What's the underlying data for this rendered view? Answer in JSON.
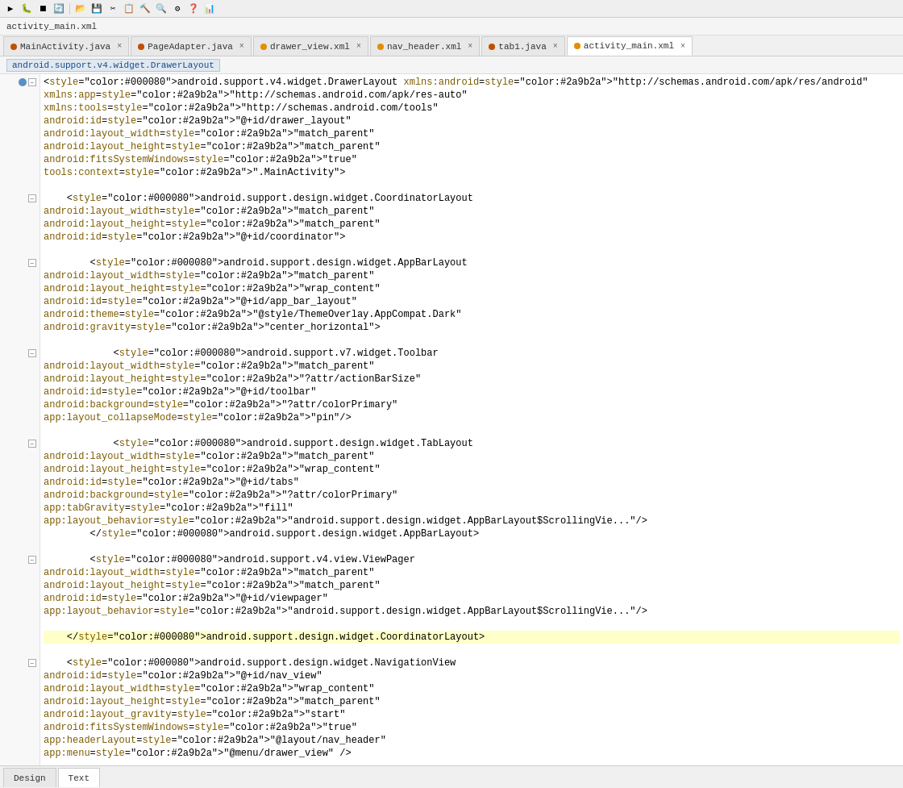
{
  "toolbar": {
    "icons": [
      "▶",
      "⏸",
      "⏹",
      "🔄",
      "📁",
      "💾",
      "✂",
      "📋",
      "📌",
      "🔍",
      "⚙",
      "❓",
      "📊"
    ]
  },
  "breadcrumb": {
    "text": "activity_main.xml"
  },
  "tabs": [
    {
      "id": "main-activity",
      "label": "MainActivity.java",
      "color": "#c05000",
      "active": false,
      "closeable": true
    },
    {
      "id": "page-adapter",
      "label": "PageAdapter.java",
      "color": "#c05000",
      "active": false,
      "closeable": true
    },
    {
      "id": "drawer-view",
      "label": "drawer_view.xml",
      "color": "#e09000",
      "active": false,
      "closeable": true
    },
    {
      "id": "nav-header",
      "label": "nav_header.xml",
      "color": "#e09000",
      "active": false,
      "closeable": true
    },
    {
      "id": "tab1",
      "label": "tab1.java",
      "color": "#c05000",
      "active": false,
      "closeable": true
    },
    {
      "id": "activity-main",
      "label": "activity_main.xml",
      "color": "#e09000",
      "active": true,
      "closeable": true
    }
  ],
  "file_path": "android.support.v4.widget.DrawerLayout",
  "code_lines": [
    {
      "indent": 0,
      "fold": true,
      "circle": true,
      "highlighted": false,
      "content": "<android.support.v4.widget.DrawerLayout xmlns:android=\"http://schemas.android.com/apk/res/android\""
    },
    {
      "indent": 1,
      "fold": false,
      "circle": false,
      "highlighted": false,
      "content": "    xmlns:app=\"http://schemas.android.com/apk/res-auto\""
    },
    {
      "indent": 1,
      "fold": false,
      "circle": false,
      "highlighted": false,
      "content": "    xmlns:tools=\"http://schemas.android.com/tools\""
    },
    {
      "indent": 1,
      "fold": false,
      "circle": false,
      "highlighted": false,
      "content": "    android:id=\"@+id/drawer_layout\""
    },
    {
      "indent": 1,
      "fold": false,
      "circle": false,
      "highlighted": false,
      "content": "    android:layout_width=\"match_parent\""
    },
    {
      "indent": 1,
      "fold": false,
      "circle": false,
      "highlighted": false,
      "content": "    android:layout_height=\"match_parent\""
    },
    {
      "indent": 1,
      "fold": false,
      "circle": false,
      "highlighted": false,
      "content": "    android:fitsSystemWindows=\"true\""
    },
    {
      "indent": 1,
      "fold": false,
      "circle": false,
      "highlighted": false,
      "content": "    tools:context=\".MainActivity\">"
    },
    {
      "indent": 0,
      "fold": false,
      "circle": false,
      "highlighted": false,
      "content": ""
    },
    {
      "indent": 1,
      "fold": true,
      "circle": false,
      "highlighted": false,
      "content": "    <android.support.design.widget.CoordinatorLayout"
    },
    {
      "indent": 2,
      "fold": false,
      "circle": false,
      "highlighted": false,
      "content": "        android:layout_width=\"match_parent\""
    },
    {
      "indent": 2,
      "fold": false,
      "circle": false,
      "highlighted": false,
      "content": "        android:layout_height=\"match_parent\""
    },
    {
      "indent": 2,
      "fold": false,
      "circle": false,
      "highlighted": false,
      "content": "        android:id=\"@+id/coordinator\">"
    },
    {
      "indent": 0,
      "fold": false,
      "circle": false,
      "highlighted": false,
      "content": ""
    },
    {
      "indent": 2,
      "fold": true,
      "circle": false,
      "highlighted": false,
      "content": "        <android.support.design.widget.AppBarLayout"
    },
    {
      "indent": 3,
      "fold": false,
      "circle": false,
      "highlighted": false,
      "content": "            android:layout_width=\"match_parent\""
    },
    {
      "indent": 3,
      "fold": false,
      "circle": false,
      "highlighted": false,
      "content": "            android:layout_height=\"wrap_content\""
    },
    {
      "indent": 3,
      "fold": false,
      "circle": false,
      "highlighted": false,
      "content": "            android:id=\"@+id/app_bar_layout\""
    },
    {
      "indent": 3,
      "fold": false,
      "circle": false,
      "highlighted": false,
      "content": "            android:theme=\"@style/ThemeOverlay.AppCompat.Dark\""
    },
    {
      "indent": 3,
      "fold": false,
      "circle": false,
      "highlighted": false,
      "content": "            android:gravity=\"center_horizontal\">"
    },
    {
      "indent": 0,
      "fold": false,
      "circle": false,
      "highlighted": false,
      "content": ""
    },
    {
      "indent": 3,
      "fold": true,
      "circle": false,
      "highlighted": false,
      "content": "            <android.support.v7.widget.Toolbar"
    },
    {
      "indent": 4,
      "fold": false,
      "circle": false,
      "highlighted": false,
      "content": "                android:layout_width=\"match_parent\""
    },
    {
      "indent": 4,
      "fold": false,
      "circle": false,
      "highlighted": false,
      "content": "                android:layout_height=\"?attr/actionBarSize\""
    },
    {
      "indent": 4,
      "fold": false,
      "circle": false,
      "highlighted": false,
      "content": "                android:id=\"@+id/toolbar\""
    },
    {
      "indent": 4,
      "fold": false,
      "circle": false,
      "highlighted": false,
      "content": "                android:background=\"?attr/colorPrimary\""
    },
    {
      "indent": 4,
      "fold": false,
      "circle": false,
      "highlighted": false,
      "content": "                app:layout_collapseMode=\"pin\"/>"
    },
    {
      "indent": 0,
      "fold": false,
      "circle": false,
      "highlighted": false,
      "content": ""
    },
    {
      "indent": 3,
      "fold": true,
      "circle": false,
      "highlighted": false,
      "content": "            <android.support.design.widget.TabLayout"
    },
    {
      "indent": 4,
      "fold": false,
      "circle": false,
      "highlighted": false,
      "content": "                android:layout_width=\"match_parent\""
    },
    {
      "indent": 4,
      "fold": false,
      "circle": false,
      "highlighted": false,
      "content": "                android:layout_height=\"wrap_content\""
    },
    {
      "indent": 4,
      "fold": false,
      "circle": false,
      "highlighted": false,
      "content": "                android:id=\"@+id/tabs\""
    },
    {
      "indent": 4,
      "fold": false,
      "circle": false,
      "highlighted": false,
      "content": "                android:background=\"?attr/colorPrimary\""
    },
    {
      "indent": 4,
      "fold": false,
      "circle": false,
      "highlighted": false,
      "content": "                app:tabGravity=\"fill\""
    },
    {
      "indent": 4,
      "fold": false,
      "circle": false,
      "highlighted": false,
      "content": "                app:layout_behavior=\"android.support.design.widget.AppBarLayout$ScrollingVie...\"/>"
    },
    {
      "indent": 3,
      "fold": false,
      "circle": false,
      "highlighted": false,
      "content": "        </android.support.design.widget.AppBarLayout>"
    },
    {
      "indent": 0,
      "fold": false,
      "circle": false,
      "highlighted": false,
      "content": ""
    },
    {
      "indent": 3,
      "fold": true,
      "circle": false,
      "highlighted": false,
      "content": "        <android.support.v4.view.ViewPager"
    },
    {
      "indent": 4,
      "fold": false,
      "circle": false,
      "highlighted": false,
      "content": "            android:layout_width=\"match_parent\""
    },
    {
      "indent": 4,
      "fold": false,
      "circle": false,
      "highlighted": false,
      "content": "            android:layout_height=\"match_parent\""
    },
    {
      "indent": 4,
      "fold": false,
      "circle": false,
      "highlighted": false,
      "content": "            android:id=\"@+id/viewpager\""
    },
    {
      "indent": 4,
      "fold": false,
      "circle": false,
      "highlighted": false,
      "content": "            app:layout_behavior=\"android.support.design.widget.AppBarLayout$ScrollingVie...\"/>"
    },
    {
      "indent": 0,
      "fold": false,
      "circle": false,
      "highlighted": false,
      "content": ""
    },
    {
      "indent": 2,
      "fold": false,
      "circle": false,
      "highlighted": true,
      "content": "    </android.support.design.widget.CoordinatorLayout>"
    },
    {
      "indent": 0,
      "fold": false,
      "circle": false,
      "highlighted": false,
      "content": ""
    },
    {
      "indent": 1,
      "fold": true,
      "circle": false,
      "highlighted": false,
      "content": "    <android.support.design.widget.NavigationView"
    },
    {
      "indent": 2,
      "fold": false,
      "circle": false,
      "highlighted": false,
      "content": "        android:id=\"@+id/nav_view\""
    },
    {
      "indent": 2,
      "fold": false,
      "circle": false,
      "highlighted": false,
      "content": "        android:layout_width=\"wrap_content\""
    },
    {
      "indent": 2,
      "fold": false,
      "circle": false,
      "highlighted": false,
      "content": "        android:layout_height=\"match_parent\""
    },
    {
      "indent": 2,
      "fold": false,
      "circle": false,
      "highlighted": false,
      "content": "        android:layout_gravity=\"start\""
    },
    {
      "indent": 2,
      "fold": false,
      "circle": false,
      "highlighted": false,
      "content": "        android:fitsSystemWindows=\"true\""
    },
    {
      "indent": 2,
      "fold": false,
      "circle": false,
      "highlighted": false,
      "content": "        app:headerLayout=\"@layout/nav_header\""
    },
    {
      "indent": 2,
      "fold": false,
      "circle": false,
      "highlighted": false,
      "content": "        app:menu=\"@menu/drawer_view\" />"
    }
  ],
  "bottom_tabs": [
    {
      "id": "design",
      "label": "Design",
      "active": false
    },
    {
      "id": "text",
      "label": "Text",
      "active": true
    }
  ]
}
